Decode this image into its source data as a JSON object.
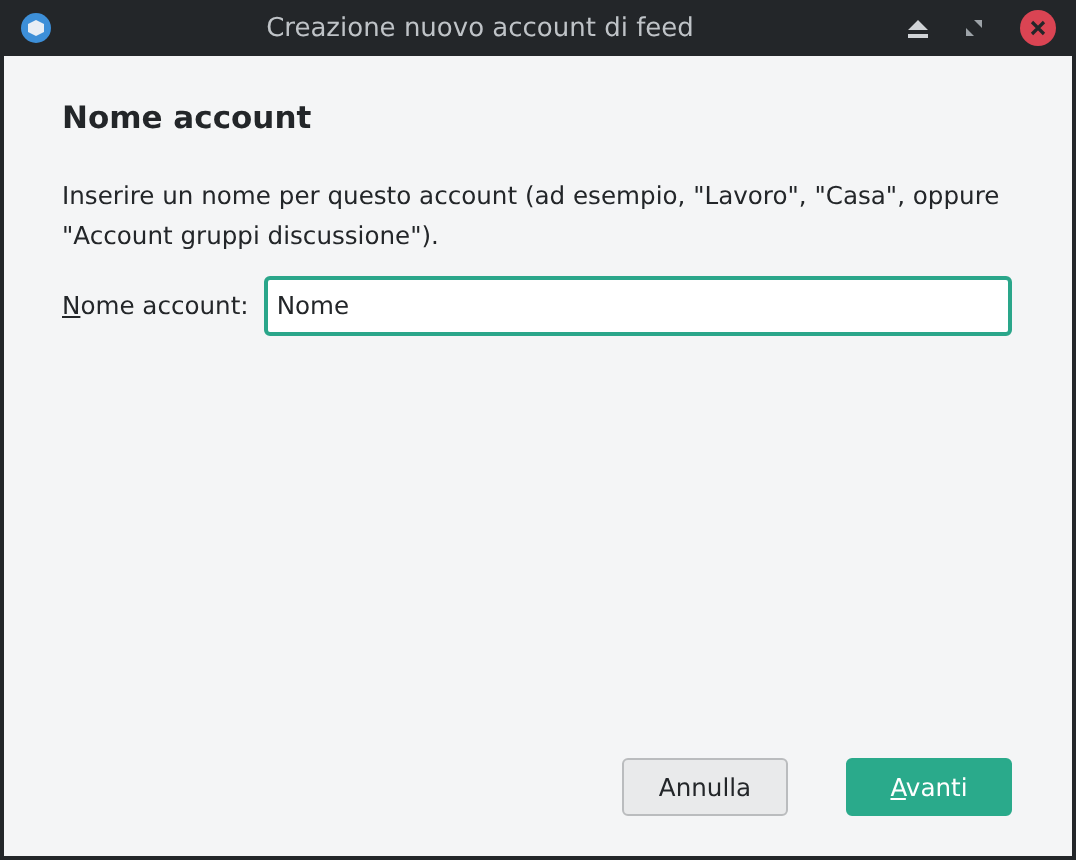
{
  "window": {
    "title": "Creazione nuovo account di feed"
  },
  "heading": "Nome account",
  "description": "Inserire un nome per questo account (ad esempio, \"Lavoro\", \"Casa\", oppure \"Account gruppi discussione\").",
  "field": {
    "label": "Nome account:",
    "value": "Nome"
  },
  "buttons": [
    {
      "label": "Annulla",
      "kind": "secondary"
    },
    {
      "label": "Avanti",
      "kind": "primary"
    }
  ]
}
